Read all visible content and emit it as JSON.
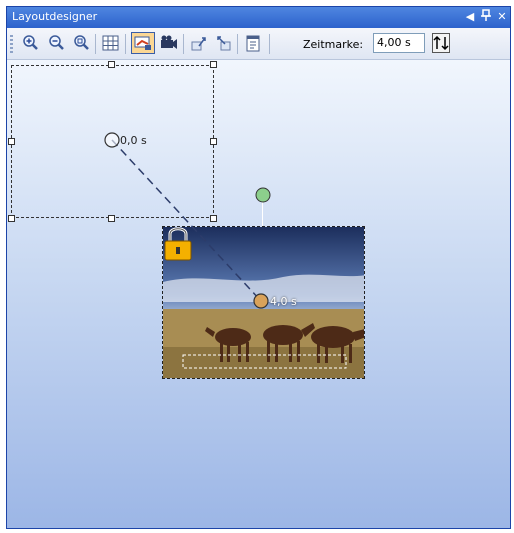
{
  "window": {
    "title": "Layoutdesigner"
  },
  "toolbar": {
    "buttons": [
      "zoom-in-icon",
      "zoom-out-icon",
      "zoom-fit-icon",
      "grid-icon",
      "motion-path-icon",
      "camera-icon",
      "bring-forward-icon",
      "send-backward-icon",
      "properties-icon"
    ],
    "zeit_label": "Zeitmarke:",
    "zeit_value": "4,00 s"
  },
  "canvas": {
    "start_time_label": "0,0 s",
    "end_time_label": "4,0 s",
    "locked": true
  },
  "colors": {
    "title_bar": "#2c62cc",
    "canvas_top": "#f1f6fd",
    "canvas_bottom": "#9cb6e6",
    "active_button": "#fbd795",
    "start_marker": "#ffffff",
    "end_marker": "#d9a25a",
    "rotate_handle": "#8ccf8c"
  }
}
